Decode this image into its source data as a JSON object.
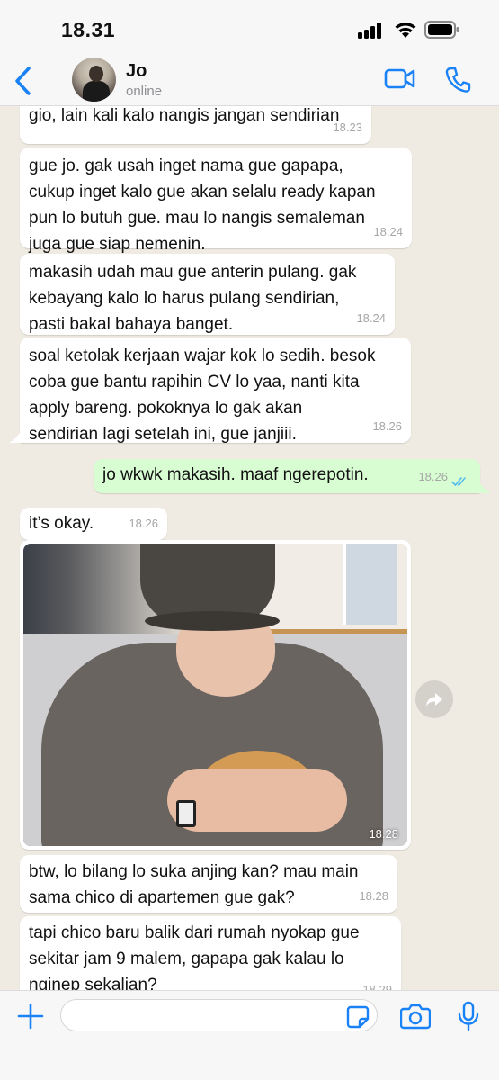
{
  "status_bar": {
    "time": "18.31"
  },
  "header": {
    "contact_name": "Jo",
    "contact_status": "online",
    "icons": [
      "back-chevron-icon",
      "video-camera-icon",
      "phone-icon"
    ]
  },
  "messages": [
    {
      "direction": "in",
      "text": "gio, lain kali kalo nangis jangan sendirian",
      "time": "18.23"
    },
    {
      "direction": "in",
      "text": "gue jo. gak usah inget nama gue gapapa,\ncukup inget kalo gue akan selalu ready kapan\npun lo butuh gue. mau lo nangis semaleman\njuga gue siap nemenin.",
      "time": "18.24"
    },
    {
      "direction": "in",
      "text": "makasih udah mau gue anterin pulang. gak\nkebayang kalo lo harus pulang sendirian,\npasti bakal bahaya banget.",
      "time": "18.24"
    },
    {
      "direction": "in",
      "text": "soal ketolak kerjaan wajar kok lo sedih. besok\ncoba gue bantu rapihin CV lo yaa, nanti kita\napply bareng. pokoknya lo gak akan\nsendirian lagi setelah ini, gue janjiii.",
      "time": "18.26"
    },
    {
      "direction": "out",
      "text": "jo wkwk makasih. maaf ngerepotin.",
      "time": "18.26",
      "read_receipt": "double-check-icon"
    },
    {
      "direction": "in",
      "text": "it’s okay.",
      "time": "18.26"
    },
    {
      "direction": "in",
      "type": "photo",
      "time": "18.28"
    },
    {
      "direction": "in",
      "text": "btw, lo bilang lo suka anjing kan? mau main\nsama chico di apartemen gue gak?",
      "time": "18.28"
    },
    {
      "direction": "in",
      "text": "tapi chico baru balik dari rumah nyokap gue\nsekitar jam 9 malem, gapapa gak kalau lo\nnginep sekalian?",
      "time": "18.29"
    }
  ],
  "input_bar": {
    "placeholder": "",
    "icons": [
      "plus-icon",
      "sticker-icon",
      "camera-icon",
      "microphone-icon"
    ]
  },
  "colors": {
    "accent": "#1a82f7",
    "incoming_bubble": "#ffffff",
    "outgoing_bubble": "#d9fdd3",
    "chat_background": "#efeae2",
    "read_receipt": "#53bdeb"
  }
}
